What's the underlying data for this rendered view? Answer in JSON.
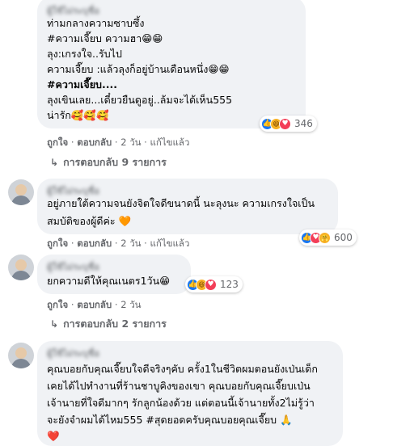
{
  "comments": [
    {
      "author": "ผู้ใช้ไม่ระบุชื่อ",
      "lines": [
        "ท่ามกลางความซาบซึ้ง",
        "#ความเจี๊ยบ ความฮา😁😁",
        "ลุง:เกรงใจ..รับไป",
        "ความเจี๊ยบ :แล้วลุงก็อยู่บ้านเดือนหนึ่ง😁😁",
        "#ความเจี๊ยบ....",
        "ลุงเขินเลย...เดี๋ยวยืนดูอยู่..ล้มจะได้เห็น555",
        "น่ารัก🥰🥰🥰"
      ],
      "reaction_count": "346",
      "reaction_icons": [
        "like-icon",
        "haha-icon",
        "love-icon"
      ],
      "actions": {
        "like": "ถูกใจ",
        "reply": "ตอบกลับ",
        "time": "2 วัน",
        "edited": "แก้ไขแล้ว"
      },
      "replies_label": "การตอบกลับ 9 รายการ"
    },
    {
      "author": "ผู้ใช้ไม่ระบุชื่อ",
      "lines": [
        "อยู่ภายใต้ความจนยังจิตใจดีขนาดนี้ นะลุงนะ ความเกรงใจเป็น",
        "สมบัติของผู้ดีค่ะ 🧡"
      ],
      "reaction_count": "600",
      "reaction_icons": [
        "like-icon",
        "love-icon",
        "care-icon"
      ],
      "actions": {
        "like": "ถูกใจ",
        "reply": "ตอบกลับ",
        "time": "2 วัน",
        "edited": "แก้ไขแล้ว"
      }
    },
    {
      "author": "ผู้ใช้ไม่ระบุชื่อ",
      "lines": [
        "ยกความดีให้คุณเนตร1วัน😁"
      ],
      "reaction_count": "123",
      "reaction_icons": [
        "like-icon",
        "haha-icon",
        "love-icon"
      ],
      "actions": {
        "like": "ถูกใจ",
        "reply": "ตอบกลับ",
        "time": "2 วัน"
      },
      "replies_label": "การตอบกลับ 2 รายการ"
    },
    {
      "author": "ผู้ใช้ไม่ระบุชื่อ",
      "lines": [
        "คุณบอยกับคุณเจี๊ยบใจดีจริงๆคับ ครั้ง1ในชีวิตผมตอนยังเป่นเด็ก",
        "เคยได้ไปทำงานที่ร้านชาบูคิงของเขา คุณบอยกับคุณเจี๊ยบเป่น",
        "เจ้านายที่ใจดีมากๆ รักลูกน้องด้วย แต่ตอนนี้เจ้านายทั้ง2ไม่รู้ว่า",
        "จะยังจำผมได้ไหม555 #สุดยอดครับคุณบอยคุณเจี๊ยบ 🙏",
        "❤️"
      ]
    }
  ],
  "colors": {
    "bubble": "#f0f2f5",
    "meta_text": "#65676b",
    "like_blue": "#1877f2",
    "love_red": "#f33e58",
    "haha_yellow": "#f7b125"
  }
}
